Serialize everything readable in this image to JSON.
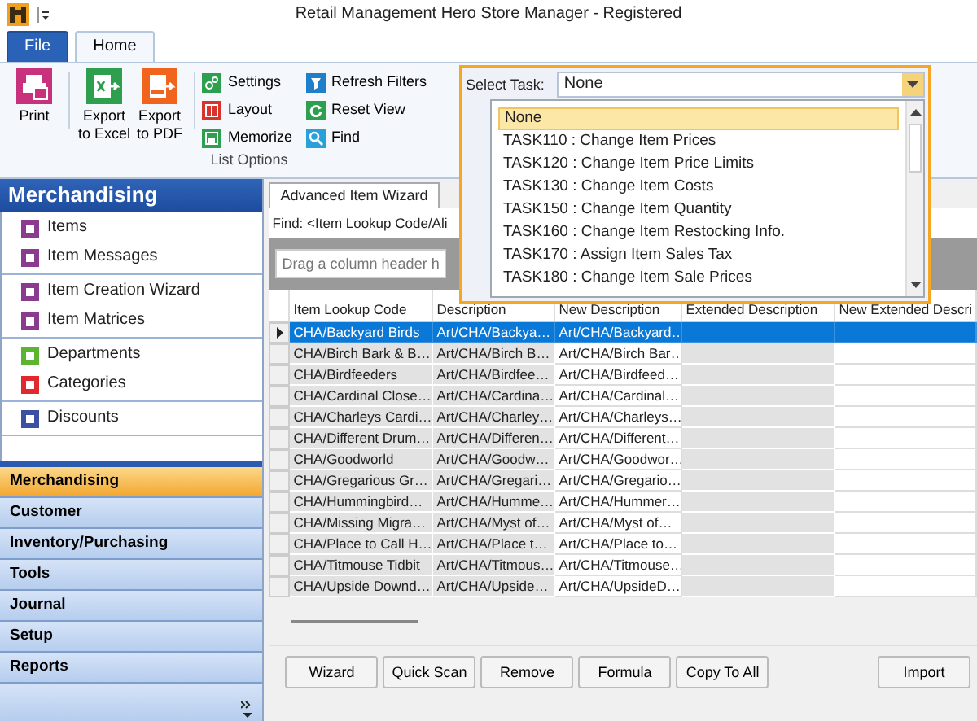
{
  "window": {
    "title": "Retail Management Hero Store Manager - Registered"
  },
  "ribbon": {
    "tabs": [
      {
        "label": "File",
        "kind": "file",
        "selected": false
      },
      {
        "label": "Home",
        "kind": "tab",
        "selected": true
      }
    ],
    "large_buttons": [
      {
        "label": "Print",
        "kind": "print"
      },
      {
        "label": "Export to Excel",
        "kind": "excel"
      },
      {
        "label": "Export to PDF",
        "kind": "pdf"
      }
    ],
    "small_buttons": [
      {
        "label": "Settings",
        "kind": "settings"
      },
      {
        "label": "Layout",
        "kind": "layout"
      },
      {
        "label": "Memorize",
        "kind": "memorize"
      },
      {
        "label": "Refresh Filters",
        "kind": "refresh_filters"
      },
      {
        "label": "Reset View",
        "kind": "reset_view"
      },
      {
        "label": "Find",
        "kind": "find"
      }
    ],
    "group_label": "List Options"
  },
  "task_selector": {
    "label": "Select Task:",
    "value": "None",
    "options": [
      {
        "label": "None",
        "selected": true
      },
      {
        "label": "TASK110 : Change Item Prices",
        "selected": false
      },
      {
        "label": "TASK120 : Change Item Price Limits",
        "selected": false
      },
      {
        "label": "TASK130 : Change Item Costs",
        "selected": false
      },
      {
        "label": "TASK150 : Change Item Quantity",
        "selected": false
      },
      {
        "label": "TASK160 : Change Item Restocking Info.",
        "selected": false
      },
      {
        "label": "TASK170 : Assign Item Sales Tax",
        "selected": false
      },
      {
        "label": "TASK180 : Change Item Sale Prices",
        "selected": false
      }
    ]
  },
  "sidebar": {
    "title": "Merchandising",
    "groups": [
      {
        "items": [
          {
            "label": "Items",
            "color": "#8b3b8f"
          },
          {
            "label": "Item Messages",
            "color": "#8b3b8f"
          }
        ]
      },
      {
        "items": [
          {
            "label": "Item Creation Wizard",
            "color": "#8b3b8f"
          },
          {
            "label": "Item Matrices",
            "color": "#8b3b8f"
          }
        ]
      },
      {
        "items": [
          {
            "label": "Departments",
            "color": "#5bb531"
          },
          {
            "label": "Categories",
            "color": "#e0282e"
          }
        ]
      },
      {
        "items": [
          {
            "label": "Discounts",
            "color": "#3d4fa0"
          }
        ]
      }
    ],
    "sections": [
      {
        "label": "Merchandising",
        "selected": true
      },
      {
        "label": "Customer",
        "selected": false
      },
      {
        "label": "Inventory/Purchasing",
        "selected": false
      },
      {
        "label": "Tools",
        "selected": false
      },
      {
        "label": "Journal",
        "selected": false
      },
      {
        "label": "Setup",
        "selected": false
      },
      {
        "label": "Reports",
        "selected": false
      }
    ]
  },
  "wizard": {
    "tabs": [
      {
        "label": "Advanced Item Wizard",
        "selected": true
      }
    ],
    "find_label": "Find: <Item Lookup Code/Ali",
    "group_panel_hint": "Drag a column header h",
    "columns": [
      {
        "label": "Item Lookup Code",
        "read_only": true
      },
      {
        "label": "Description",
        "read_only": true
      },
      {
        "label": "New Description",
        "read_only": false
      },
      {
        "label": "Extended Description",
        "read_only": true
      },
      {
        "label": "New Extended Descri",
        "read_only": false
      }
    ],
    "rows": [
      {
        "selected": true,
        "cells": [
          "CHA/Backyard Birds",
          "Art/CHA/Backya…",
          "Art/CHA/Backyard…"
        ]
      },
      {
        "selected": false,
        "cells": [
          "CHA/Birch Bark & B…",
          "Art/CHA/Birch B…",
          "Art/CHA/Birch Bar…"
        ]
      },
      {
        "selected": false,
        "cells": [
          "CHA/Birdfeeders",
          "Art/CHA/Birdfee…",
          "Art/CHA/Birdfeed…"
        ]
      },
      {
        "selected": false,
        "cells": [
          "CHA/Cardinal Close…",
          "Art/CHA/Cardina…",
          "Art/CHA/Cardinal…"
        ]
      },
      {
        "selected": false,
        "cells": [
          "CHA/Charleys Cardi…",
          "Art/CHA/Charley…",
          "Art/CHA/Charleys…"
        ]
      },
      {
        "selected": false,
        "cells": [
          "CHA/Different Drum…",
          "Art/CHA/Differen…",
          "Art/CHA/Different…"
        ]
      },
      {
        "selected": false,
        "cells": [
          "CHA/Goodworld",
          "Art/CHA/Goodw…",
          "Art/CHA/Goodwor…"
        ]
      },
      {
        "selected": false,
        "cells": [
          "CHA/Gregarious Gr…",
          "Art/CHA/Gregari…",
          "Art/CHA/Gregario…"
        ]
      },
      {
        "selected": false,
        "cells": [
          "CHA/Hummingbird…",
          "Art/CHA/Humme…",
          "Art/CHA/Hummer…"
        ]
      },
      {
        "selected": false,
        "cells": [
          "CHA/Missing Migra…",
          "Art/CHA/Myst of…",
          "Art/CHA/Myst of…"
        ]
      },
      {
        "selected": false,
        "cells": [
          "CHA/Place to Call H…",
          "Art/CHA/Place t…",
          "Art/CHA/Place to…"
        ]
      },
      {
        "selected": false,
        "cells": [
          "CHA/Titmouse Tidbit",
          "Art/CHA/Titmous…",
          "Art/CHA/Titmouse…"
        ]
      },
      {
        "selected": false,
        "cells": [
          "CHA/Upside Downd…",
          "Art/CHA/Upside…",
          "Art/CHA/UpsideD…"
        ]
      }
    ],
    "buttons": [
      {
        "label": "Wizard",
        "kind": "left"
      },
      {
        "label": "Quick Scan",
        "kind": "left"
      },
      {
        "label": "Remove",
        "kind": "left"
      },
      {
        "label": "Formula",
        "kind": "left"
      },
      {
        "label": "Copy To All",
        "kind": "left"
      },
      {
        "label": "Import",
        "kind": "right"
      }
    ]
  }
}
